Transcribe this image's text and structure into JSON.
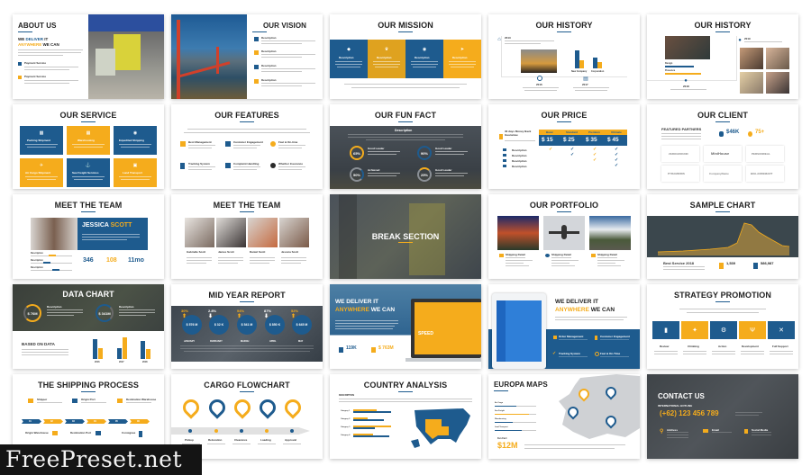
{
  "colors": {
    "blue": "#1e5b8e",
    "yellow": "#f5ac1c",
    "dark": "#3d464f",
    "text": "#222222"
  },
  "slides": [
    {
      "title": "ABOUT US",
      "headline_1": "WE ",
      "headline_2": "DELIVER",
      "headline_3": " IT",
      "headline_4": "ANYWHERE",
      "headline_5": " WE CAN",
      "items": [
        "Payment Service",
        "Payment Service"
      ]
    },
    {
      "title": "OUR VISION",
      "items": [
        "Description",
        "Description",
        "Description",
        "Description"
      ]
    },
    {
      "title": "OUR MISSION",
      "boxes": [
        "Description",
        "Description",
        "Description",
        "Description"
      ]
    },
    {
      "title": "OUR HISTORY",
      "years": [
        "2013",
        "2016",
        "2017"
      ],
      "bar_labels": [
        "New Company",
        "Corporation"
      ]
    },
    {
      "title": "OUR HISTORY",
      "years": [
        "2019",
        "2018"
      ],
      "bars": [
        "Design",
        "Presence"
      ]
    },
    {
      "title": "OUR SERVICE",
      "boxes": [
        "Packing Shipment",
        "Warehousing",
        "Expedited Shipping",
        "Air Cargo Shipment",
        "Sea Freight Services",
        "Land Transport"
      ]
    },
    {
      "title": "OUR FEATURES",
      "items": [
        "Best Management",
        "Customer Engagement",
        "Fast & On-time",
        "Tracking System",
        "Complaint Handling",
        "Whether Insurance"
      ]
    },
    {
      "title": "OUR FUN FACT",
      "heading": "Description",
      "stats": [
        {
          "value": "65%",
          "label": "Good Leader"
        },
        {
          "value": "90%",
          "label": "Good Leader"
        },
        {
          "value": "50%",
          "label": "Achieved"
        },
        {
          "value": "25%",
          "label": "Good Leader"
        }
      ]
    },
    {
      "title": "OUR PRICE",
      "guarantee": "30 days Money Back Guarantee",
      "plans": [
        "Basic",
        "Standard",
        "Premium",
        "Ultimate"
      ],
      "prices": [
        "$ 15",
        "$ 25",
        "$ 35",
        "$ 45"
      ],
      "rows": [
        "Description",
        "Description",
        "Description",
        "Description"
      ]
    },
    {
      "title": "OUR CLIENT",
      "subtitle": "FEATURED PARTNERS",
      "stat_1": "$46K",
      "stat_2": "75+",
      "partners": [
        "ZEROGROUND",
        "MiniHouse",
        "PERSONREAL",
        "PYRAMIDRIS",
        "CompanyName",
        "BIGLANDEMART"
      ]
    },
    {
      "title": "MEET THE TEAM",
      "name_1": "JESSICA ",
      "name_2": "SCOTT",
      "skills": [
        "Description",
        "Description",
        "Description"
      ],
      "stats": [
        "346",
        "108",
        "11mo"
      ]
    },
    {
      "title": "MEET THE TEAM",
      "members": [
        "Gabrielle Scott",
        "James Scott",
        "Daniel Scott",
        "Jessica Scott"
      ]
    },
    {
      "title": "BREAK SECTION"
    },
    {
      "title": "OUR PORTFOLIO",
      "items": [
        "Shipping Detail",
        "Shipping Detail",
        "Shipping Detail"
      ]
    },
    {
      "title": "SAMPLE CHART",
      "footer": "Best Service 2018",
      "stat_1": "1,539",
      "stat_2": "586,987"
    },
    {
      "title": "DATA CHART",
      "circle_1": "$ 76M",
      "circle_2": "$ 341M",
      "desc": "Description",
      "section": "BASED ON DATA",
      "bar_labels": [
        "2016",
        "2017",
        "2018"
      ]
    },
    {
      "title": "MID YEAR REPORT",
      "months": [
        {
          "pct": "30%",
          "dir": "up",
          "value": "$ 576 M",
          "label": "JANUARY"
        },
        {
          "pct": "2.8%",
          "dir": "down",
          "value": "$ 32 K",
          "label": "FEBRUARY"
        },
        {
          "pct": "94%",
          "dir": "up",
          "value": "$ 541 M",
          "label": "MARCH"
        },
        {
          "pct": "87%",
          "dir": "down",
          "value": "$ 850 K",
          "label": "APRIL"
        },
        {
          "pct": "52%",
          "dir": "up",
          "value": "$ 645 M",
          "label": "MAY"
        }
      ]
    },
    {
      "headline_1": "WE DELIVER IT",
      "headline_2": "ANYWHERE",
      "headline_3": " WE CAN",
      "stat_1": "119K",
      "stat_2": "$ 763M",
      "screen_text": "SPEED"
    },
    {
      "headline_1": "WE DELIVER IT",
      "headline_2": "ANYWHERE",
      "headline_3": " WE CAN",
      "items": [
        "Order Management",
        "Customer Engagement",
        "Tracking System",
        "Fast & On-Time"
      ]
    },
    {
      "title": "STRATEGY PROMOTION",
      "steps": [
        "Review",
        "Climbing",
        "Action",
        "Development",
        "Full Support"
      ]
    },
    {
      "title": "THE SHIPPING PROCESS",
      "top": [
        "Shipper",
        "Origin Port",
        "Destination Warehouse"
      ],
      "bottom": [
        "Origin Warehouse",
        "Destination Port",
        "Consignee"
      ],
      "steps": [
        "01",
        "02",
        "03",
        "04",
        "05",
        "06"
      ]
    },
    {
      "title": "CARGO FLOWCHART",
      "steps": [
        "Pickup",
        "Relocation",
        "Clearance",
        "Loading",
        "Approval"
      ]
    },
    {
      "title": "COUNTRY ANALYSIS",
      "subtitle": "DESCRIPTION",
      "categories": [
        "Category 1",
        "Category 2",
        "Category 3",
        "Category 4"
      ]
    },
    {
      "title": "EUROPA MAPS",
      "bars": [
        "Air Cargo",
        "Sea Freight",
        "Warehousing",
        "Land Transport"
      ],
      "fact_label": "Fun Fact",
      "fact_value": "$12M"
    },
    {
      "title": "CONTACT US",
      "hotline_label": "INTERNATIONAL HOTLINE",
      "phone": "(+62) 123 456 789",
      "fields": [
        "Address",
        "Email",
        "Social Media"
      ]
    }
  ],
  "watermark": "FreePreset.net"
}
